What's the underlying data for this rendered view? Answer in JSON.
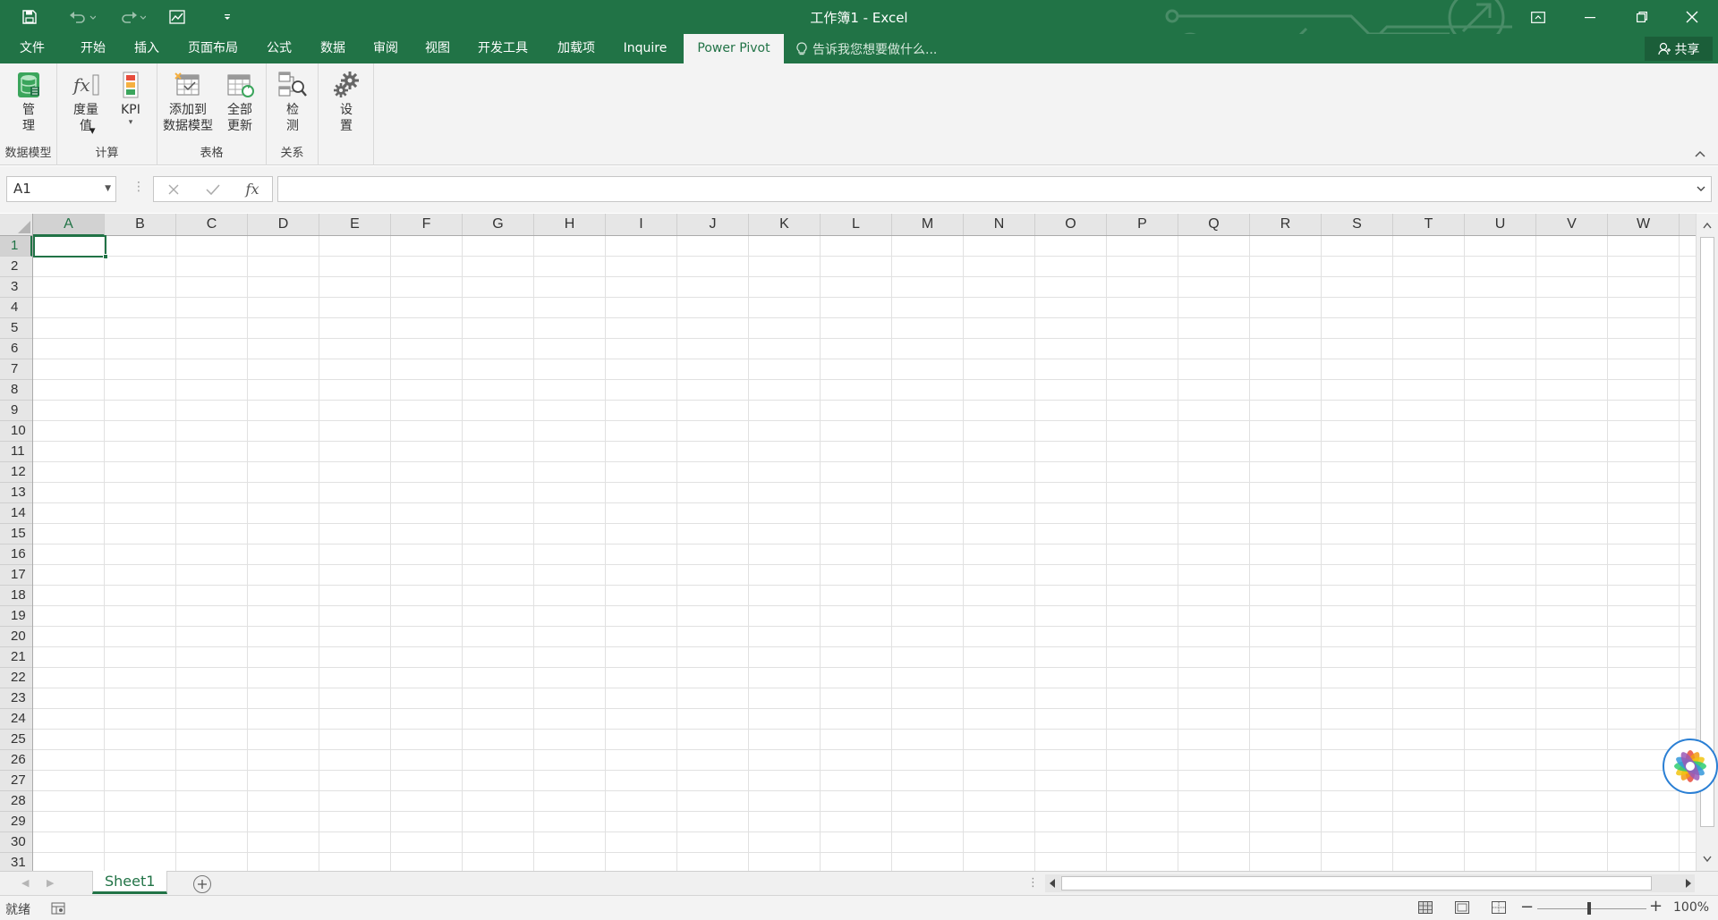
{
  "window": {
    "title": "工作簿1 - Excel"
  },
  "colors": {
    "brand": "#217346",
    "ribbon": "#f3f3f3"
  },
  "tabs": [
    {
      "label": "文件"
    },
    {
      "label": "开始"
    },
    {
      "label": "插入"
    },
    {
      "label": "页面布局"
    },
    {
      "label": "公式"
    },
    {
      "label": "数据"
    },
    {
      "label": "审阅"
    },
    {
      "label": "视图"
    },
    {
      "label": "开发工具"
    },
    {
      "label": "加载项"
    },
    {
      "label": "Inquire"
    },
    {
      "label": "Power Pivot",
      "active": true
    }
  ],
  "tell_me": {
    "placeholder": "告诉我您想要做什么..."
  },
  "share": {
    "label": "共享"
  },
  "ribbon": {
    "groups": [
      {
        "label": "数据模型",
        "buttons": [
          {
            "label": "管\n理",
            "icon": "manage-data-model-icon"
          }
        ]
      },
      {
        "label": "计算",
        "buttons": [
          {
            "label": "度量\n值",
            "icon": "measures-icon",
            "dropdown": true
          },
          {
            "label": "KPI",
            "icon": "kpi-icon",
            "dropdown": true
          }
        ]
      },
      {
        "label": "表格",
        "buttons": [
          {
            "label": "添加到\n数据模型",
            "icon": "add-to-data-model-icon"
          },
          {
            "label": "全部\n更新",
            "icon": "refresh-all-icon"
          }
        ]
      },
      {
        "label": "关系",
        "buttons": [
          {
            "label": "检\n测",
            "icon": "detect-icon"
          }
        ]
      },
      {
        "label": "",
        "buttons": [
          {
            "label": "设\n置",
            "icon": "settings-icon"
          }
        ]
      }
    ]
  },
  "formula_bar": {
    "name_box": "A1",
    "formula": "",
    "fx_label": "fx"
  },
  "grid": {
    "columns": [
      "A",
      "B",
      "C",
      "D",
      "E",
      "F",
      "G",
      "H",
      "I",
      "J",
      "K",
      "L",
      "M",
      "N",
      "O",
      "P",
      "Q",
      "R",
      "S",
      "T",
      "U",
      "V",
      "W"
    ],
    "rows": [
      "1",
      "2",
      "3",
      "4",
      "5",
      "6",
      "7",
      "8",
      "9",
      "10",
      "11",
      "12",
      "13",
      "14",
      "15",
      "16",
      "17",
      "18",
      "19",
      "20",
      "21",
      "22",
      "23",
      "24",
      "25",
      "26",
      "27",
      "28",
      "29",
      "30",
      "31"
    ],
    "active_column": "A",
    "active_row": "1"
  },
  "sheets": [
    {
      "name": "Sheet1",
      "active": true
    }
  ],
  "status": {
    "text": "就绪",
    "zoom": "100%"
  }
}
